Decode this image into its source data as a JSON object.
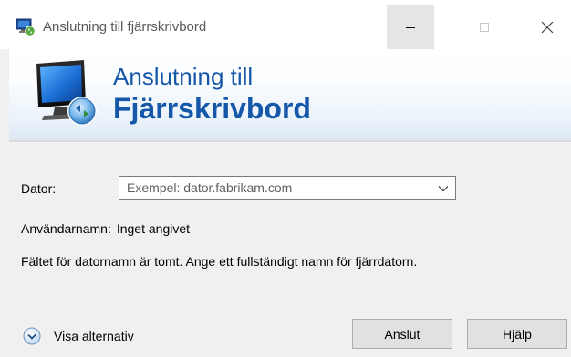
{
  "window": {
    "title": "Anslutning till fjärrskrivbord",
    "icon": "remote-desktop-icon",
    "controls": [
      "minimize-icon",
      "maximize-icon",
      "close-icon"
    ]
  },
  "banner": {
    "line1": "Anslutning till",
    "line2": "Fjärrskrivbord",
    "logo": "remote-desktop-logo",
    "text_color": "#1557a8"
  },
  "form": {
    "computer_label": "Dator:",
    "computer_placeholder": "Exempel: dator.fabrikam.com",
    "computer_value": "",
    "username_label": "Användarnamn:",
    "username_value": "Inget angivet",
    "message": "Fältet för datornamn är tomt. Ange ett fullständigt namn för fjärrdatorn."
  },
  "footer": {
    "show_options_pre": "Visa ",
    "show_options_accel": "a",
    "show_options_post": "lternativ",
    "connect_label": "Anslut",
    "help_label": "Hjälp"
  }
}
